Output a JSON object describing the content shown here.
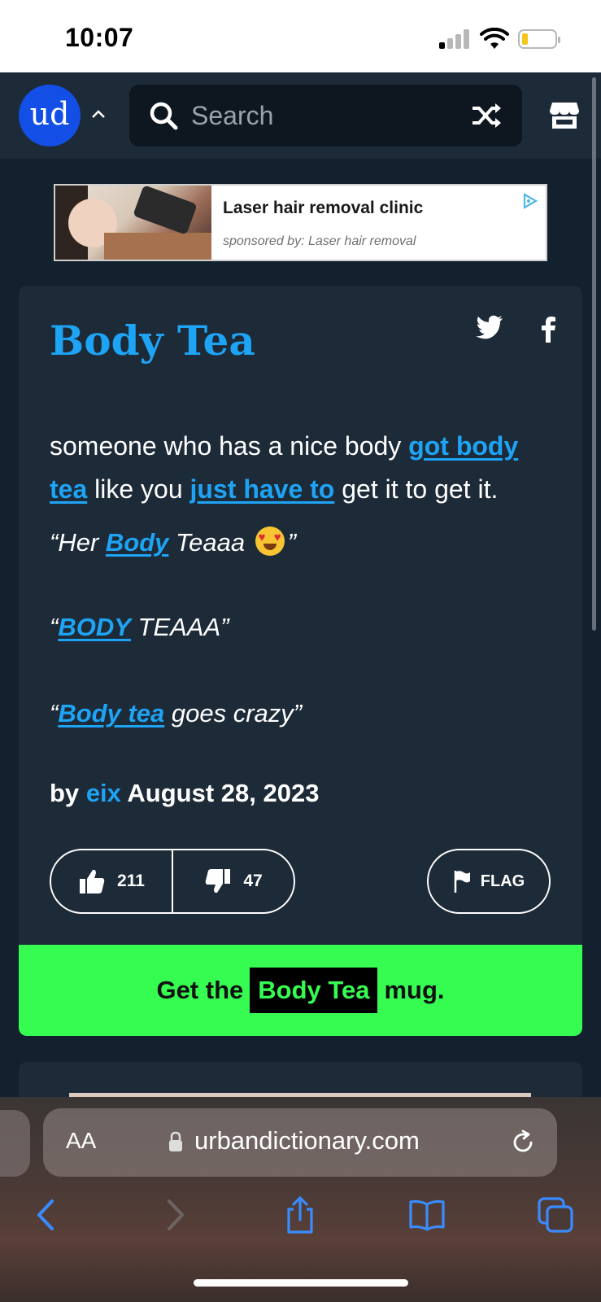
{
  "status_bar": {
    "time": "10:07"
  },
  "nav": {
    "logo_text": "ud",
    "search_placeholder": "Search"
  },
  "ad": {
    "title": "Laser hair removal clinic",
    "sponsor": "sponsored by: Laser hair removal"
  },
  "entry": {
    "word": "Body Tea",
    "meaning": {
      "t1": "someone who has a nice body ",
      "link1": "got body tea",
      "t2": " like you ",
      "link2": "just have to",
      "t3": " get it to get it."
    },
    "examples": [
      {
        "open": "“Her ",
        "link": "Body",
        "rest": " Teaaa ",
        "close": "”"
      },
      {
        "open": "“",
        "link": "BODY",
        "rest": " TEAAA”"
      },
      {
        "open": "“",
        "link": "Body tea",
        "rest": " goes crazy”"
      }
    ],
    "by_label": "by",
    "author": "eix",
    "date": "August 28, 2023",
    "upvotes": "211",
    "downvotes": "47",
    "flag_label": "FLAG",
    "mug": {
      "prefix": "Get the",
      "word": "Body Tea",
      "suffix": "mug."
    }
  },
  "browser": {
    "aa_label": "AA",
    "url": "urbandictionary.com"
  },
  "colors": {
    "link_blue": "#1ea4f5",
    "card_bg": "#1d2a38",
    "page_bg": "#13202d",
    "mug_green": "#36fc52",
    "logo_blue": "#134fe6"
  },
  "icons": [
    "search-icon",
    "shuffle-icon",
    "store-icon",
    "twitter-icon",
    "facebook-icon",
    "thumbs-up-icon",
    "thumbs-down-icon",
    "flag-icon",
    "lock-icon",
    "reload-icon",
    "back-icon",
    "forward-icon",
    "share-icon",
    "bookmarks-icon",
    "tabs-icon"
  ]
}
